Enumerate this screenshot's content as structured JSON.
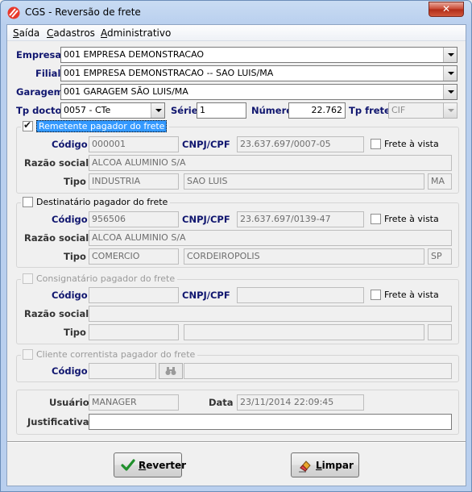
{
  "window": {
    "title": "CGS - Reversão de frete",
    "close_glyph": "✕"
  },
  "menu": [
    {
      "u": "S",
      "rest": "aída"
    },
    {
      "u": "C",
      "rest": "adastros"
    },
    {
      "u": "A",
      "rest": "dministrativo"
    }
  ],
  "header": {
    "empresa_label": "Empresa",
    "empresa_value": "001 EMPRESA DEMONSTRACAO",
    "filial_label": "Filial",
    "filial_value": "001 EMPRESA DEMONSTRACAO -- SAO LUIS/MA",
    "garagem_label": "Garagem",
    "garagem_value": "001 GARAGEM SÃO LUIS/MA",
    "tpdocto_label": "Tp docto",
    "tpdocto_value": "0057 - CTe",
    "serie_label": "Série",
    "serie_value": "1",
    "numero_label": "Número",
    "numero_value": "22.762",
    "tpfrete_label": "Tp frete",
    "tpfrete_value": "CIF"
  },
  "labels": {
    "codigo": "Código",
    "cnpj": "CNPJ/CPF",
    "razao": "Razão social",
    "tipo": "Tipo",
    "frete_vista": "Frete à vista",
    "usuario": "Usuário",
    "data": "Data",
    "justificativa": "Justificativa"
  },
  "remetente": {
    "title": "Remetente pagador do frete",
    "checked": true,
    "codigo": "000001",
    "cnpj": "23.637.697/0007-05",
    "razao": "ALCOA ALUMINIO S/A",
    "tipo": "INDUSTRIA",
    "cidade": "SAO LUIS",
    "uf": "MA"
  },
  "destinatario": {
    "title": "Destinatário pagador do frete",
    "checked": false,
    "codigo": "956506",
    "cnpj": "23.637.697/0139-47",
    "razao": "ALCOA ALUMINIO S/A",
    "tipo": "COMERCIO",
    "cidade": "CORDEIROPOLIS",
    "uf": "SP"
  },
  "consignatario": {
    "title": "Consignatário pagador do frete",
    "checked": false,
    "codigo": "",
    "cnpj": "",
    "razao": "",
    "tipo": "",
    "cidade": "",
    "uf": ""
  },
  "correntista": {
    "title": "Cliente correntista pagador do frete",
    "checked": false,
    "codigo": "",
    "nome": ""
  },
  "footer": {
    "usuario": "MANAGER",
    "data": "23/11/2014 22:09:45",
    "justificativa": ""
  },
  "buttons": {
    "reverter_u": "R",
    "reverter_rest": "everter",
    "limpar_u": "L",
    "limpar_rest": "impar"
  },
  "colors": {
    "label_blue": "#10166f",
    "selection": "#3399ff",
    "close_red": "#c7452f"
  },
  "icons": {
    "app": "cgs-logo-icon",
    "reverter": "check-icon",
    "limpar": "eraser-icon",
    "lookup": "binoculars-icon"
  }
}
